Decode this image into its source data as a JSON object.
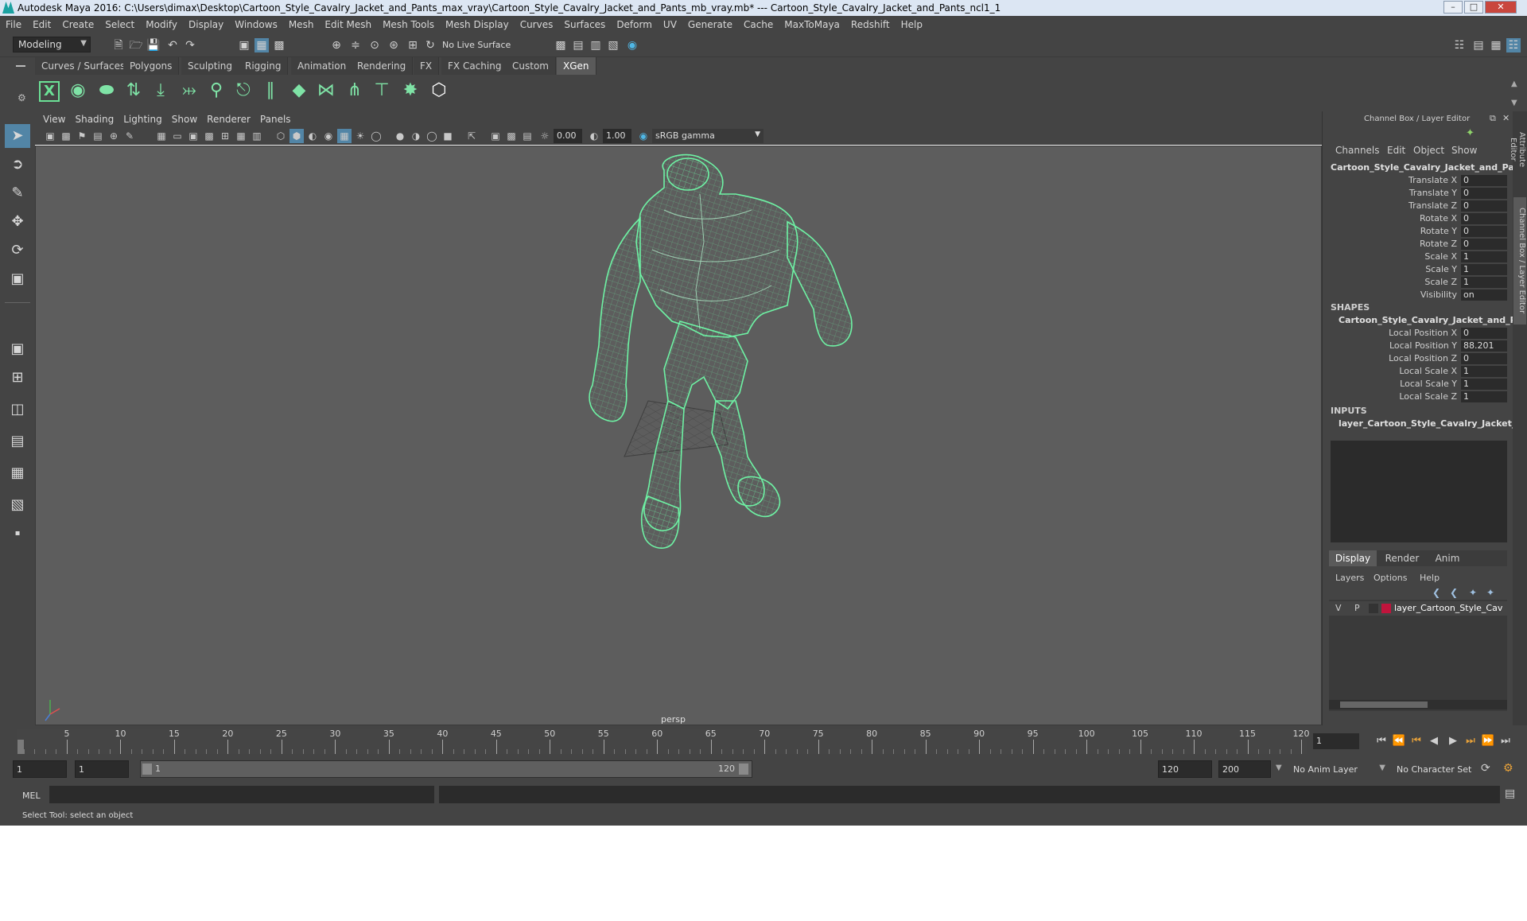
{
  "titlebar": {
    "title": "Autodesk Maya 2016: C:\\Users\\dimax\\Desktop\\Cartoon_Style_Cavalry_Jacket_and_Pants_max_vray\\Cartoon_Style_Cavalry_Jacket_and_Pants_mb_vray.mb*   ---   Cartoon_Style_Cavalry_Jacket_and_Pants_ncl1_1"
  },
  "menubar": [
    "File",
    "Edit",
    "Create",
    "Select",
    "Modify",
    "Display",
    "Windows",
    "Mesh",
    "Edit Mesh",
    "Mesh Tools",
    "Mesh Display",
    "Curves",
    "Surfaces",
    "Deform",
    "UV",
    "Generate",
    "Cache",
    "MaxToMaya",
    "Redshift",
    "Help"
  ],
  "statusline": {
    "mode": "Modeling",
    "live_surface": "No Live Surface"
  },
  "shelf": {
    "tabs": [
      "Curves / Surfaces",
      "Polygons",
      "Sculpting",
      "Rigging",
      "Animation",
      "Rendering",
      "FX",
      "FX Caching",
      "Custom",
      "XGen"
    ],
    "active_tab": "XGen"
  },
  "viewport": {
    "menu": [
      "View",
      "Shading",
      "Lighting",
      "Show",
      "Renderer",
      "Panels"
    ],
    "exposure": "0.00",
    "gamma": "1.00",
    "color_space": "sRGB gamma",
    "camera_label": "persp",
    "wire_color": "#6ef2a4",
    "background": "#5d5d5d"
  },
  "channelbox": {
    "panel_title": "Channel Box / Layer Editor",
    "menu": [
      "Channels",
      "Edit",
      "Object",
      "Show"
    ],
    "object_name": "Cartoon_Style_Cavalry_Jacket_and_Pant...",
    "channels": [
      {
        "label": "Translate X",
        "value": "0"
      },
      {
        "label": "Translate Y",
        "value": "0"
      },
      {
        "label": "Translate Z",
        "value": "0"
      },
      {
        "label": "Rotate X",
        "value": "0"
      },
      {
        "label": "Rotate Y",
        "value": "0"
      },
      {
        "label": "Rotate Z",
        "value": "0"
      },
      {
        "label": "Scale X",
        "value": "1"
      },
      {
        "label": "Scale Y",
        "value": "1"
      },
      {
        "label": "Scale Z",
        "value": "1"
      },
      {
        "label": "Visibility",
        "value": "on"
      }
    ],
    "shapes_header": "SHAPES",
    "shape_name": "Cartoon_Style_Cavalry_Jacket_and_Pa...",
    "shape_channels": [
      {
        "label": "Local Position X",
        "value": "0"
      },
      {
        "label": "Local Position Y",
        "value": "88.201"
      },
      {
        "label": "Local Position Z",
        "value": "0"
      },
      {
        "label": "Local Scale X",
        "value": "1"
      },
      {
        "label": "Local Scale Y",
        "value": "1"
      },
      {
        "label": "Local Scale Z",
        "value": "1"
      }
    ],
    "inputs_header": "INPUTS",
    "input_name": "layer_Cartoon_Style_Cavalry_Jacket_an...",
    "layer_tabs": [
      "Display",
      "Render",
      "Anim"
    ],
    "active_layer_tab": "Display",
    "layer_menu": [
      "Layers",
      "Options",
      "Help"
    ],
    "layer": {
      "v": "V",
      "p": "P",
      "name": "layer_Cartoon_Style_Cav",
      "color": "#c0143c"
    },
    "side_tabs": [
      "Attribute Editor",
      "Channel Box / Layer Editor"
    ]
  },
  "timeslider": {
    "ticks": [
      "5",
      "10",
      "15",
      "20",
      "25",
      "30",
      "35",
      "40",
      "45",
      "50",
      "55",
      "60",
      "65",
      "70",
      "75",
      "80",
      "85",
      "90",
      "95",
      "100",
      "105",
      "110",
      "115",
      "120"
    ],
    "first_label": "1",
    "current_frame": "1"
  },
  "rangeslider": {
    "start": "1",
    "playback_start": "1",
    "range_start_label": "1",
    "range_end_label": "120",
    "playback_end": "120",
    "end": "200",
    "anim_layer": "No Anim Layer",
    "character_set": "No Character Set"
  },
  "cmdline": {
    "label": "MEL"
  },
  "helpline": {
    "text": "Select Tool: select an object"
  }
}
